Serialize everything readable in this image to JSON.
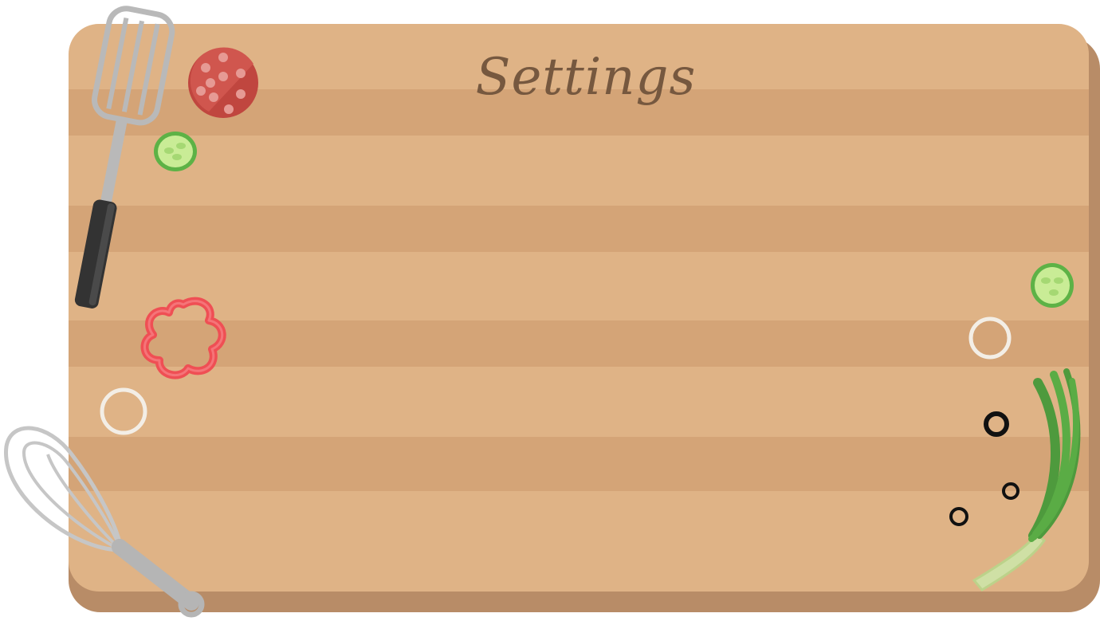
{
  "screen": {
    "title": "Settings"
  },
  "colors": {
    "board_light": "#dfb386",
    "board_dark": "#d4a477",
    "board_edge": "#b88c67",
    "title_text": "#76583f"
  },
  "decorations": [
    "spatula-icon",
    "whisk-icon",
    "salami-slice-icon",
    "cucumber-slice-icon",
    "red-pepper-ring-icon",
    "onion-ring-icon",
    "green-onion-icon",
    "peppercorn-icon"
  ]
}
